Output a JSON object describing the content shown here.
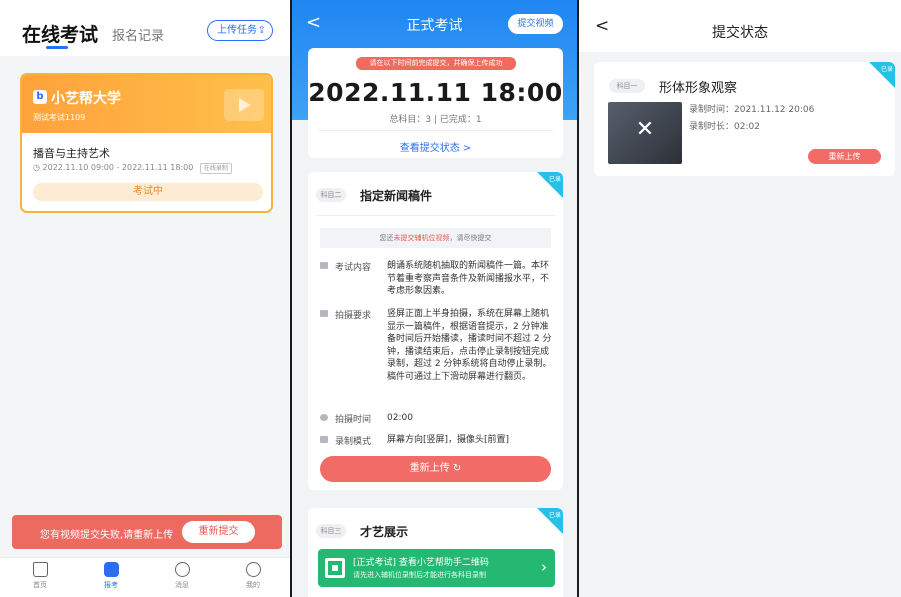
{
  "colors": {
    "primary": "#2b6ef3",
    "orange": "#ffa23c",
    "red": "#ed6a60",
    "green": "#25b873"
  },
  "panel1": {
    "title": "在线考试",
    "tab_records": "报名记录",
    "upload_task": "上传任务",
    "upload_icon": "cloud-upload-icon",
    "exam": {
      "school": "小艺帮大学",
      "sub": "测试考试1109",
      "subject": "播音与主持艺术",
      "time": "2022.11.10 09:00 - 2022.11.11 18:00",
      "badge": "在线录制",
      "status": "考试中"
    },
    "toast": {
      "text": "您有视频提交失败,请重新上传",
      "button": "重新提交"
    },
    "nav": [
      {
        "label": "首页",
        "icon": "home-icon"
      },
      {
        "label": "报考",
        "icon": "exam-icon"
      },
      {
        "label": "消息",
        "icon": "message-icon"
      },
      {
        "label": "我的",
        "icon": "profile-icon"
      }
    ]
  },
  "panel2": {
    "title": "正式考试",
    "submit_video": "提交视频",
    "deadline_warning": "请在以下时间前完成提交，并确保上传成功",
    "deadline": "2022.11.11 18:00",
    "counts": "总科目：3 | 已完成：1",
    "view_status": "查看提交状态 >",
    "task2": {
      "pill": "科目二",
      "title": "指定新闻稿件",
      "ribbon": "已录",
      "notice_prefix": "您还",
      "notice_red": "未提交辅机位视频",
      "notice_suffix": "，请尽快提交",
      "rows": [
        {
          "label": "考试内容",
          "value": "朗诵系统随机抽取的新闻稿件一篇。本环节着重考察声音条件及新闻播报水平，不考虑形象因素。"
        },
        {
          "label": "拍摄要求",
          "value": "竖屏正面上半身拍摄，系统在屏幕上随机显示一篇稿件，根据语音提示，2 分钟准备时间后开始播读，播读时间不超过 2 分钟，播读结束后，点击停止录制按钮完成录制，超过 2 分钟系统将自动停止录制。稿件可通过上下滑动屏幕进行翻页。"
        },
        {
          "label": "拍摄时间",
          "value": "02:00"
        },
        {
          "label": "录制模式",
          "value": "屏幕方向[竖屏]，摄像头[前置]"
        }
      ],
      "reupload": "重新上传 ↻"
    },
    "task3": {
      "pill": "科目三",
      "title": "才艺展示",
      "ribbon": "已录"
    },
    "qr": {
      "line1": "[正式考试] 查看小艺帮助手二维码",
      "line2": "请先进入辅机位录制后才能进行各科目录制"
    }
  },
  "panel3": {
    "title": "提交状态",
    "card": {
      "pill": "科目一",
      "title": "形体形象观察",
      "ribbon": "已录",
      "time": "录制时间：2021.11.12 20:06",
      "duration": "录制时长：02:02",
      "reupload": "重新上传"
    }
  }
}
